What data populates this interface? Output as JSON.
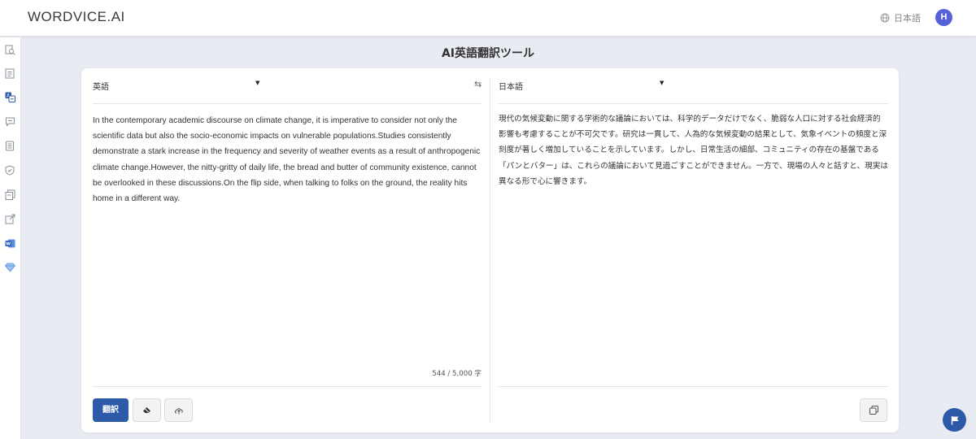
{
  "header": {
    "logo": "WORDVICE.AI",
    "language_label": "日本語",
    "avatar_initial": "H"
  },
  "sidebar": {
    "items": [
      {
        "icon": "document-search-icon"
      },
      {
        "icon": "document-list-icon"
      },
      {
        "icon": "translate-icon",
        "active": true
      },
      {
        "icon": "chat-icon"
      },
      {
        "icon": "summary-icon"
      },
      {
        "icon": "shield-icon"
      },
      {
        "icon": "documents-icon"
      },
      {
        "icon": "external-link-icon"
      },
      {
        "icon": "word-icon"
      },
      {
        "icon": "diamond-icon"
      }
    ]
  },
  "page": {
    "title": "AI英語翻訳ツール"
  },
  "source": {
    "language": "英語",
    "text": "In the contemporary academic discourse on climate change, it is imperative to consider not only the scientific data but also the socio-economic impacts on vulnerable populations.Studies consistently demonstrate a stark increase in the frequency and severity of weather events as a result of anthropogenic climate change.However, the nitty-gritty of daily life, the bread and butter of community existence, cannot be overlooked in these discussions.On the flip side, when talking to folks on the ground, the reality hits home in a different way.",
    "char_count": "544 / 5,000 字"
  },
  "target": {
    "language": "日本語",
    "text": "現代の気候変動に関する学術的な議論においては、科学的データだけでなく、脆弱な人口に対する社会経済的影響も考慮することが不可欠です。研究は一貫して、人為的な気候変動の結果として、気象イベントの頻度と深刻度が著しく増加していることを示しています。しかし、日常生活の細部、コミュニティの存在の基盤である「パンとバター」は、これらの議論において見過ごすことができません。一方で、現場の人々と話すと、現実は異なる形で心に響きます。"
  },
  "actions": {
    "translate_label": "翻訳"
  },
  "colors": {
    "accent": "#2c5aa8",
    "avatar": "#5561d7",
    "background": "#e9ebf2"
  }
}
